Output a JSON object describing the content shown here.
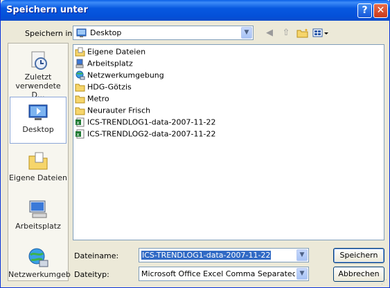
{
  "window": {
    "title": "Speichern unter"
  },
  "toolbar": {
    "save_in_label": "Speichern in:",
    "save_in_value": "Desktop"
  },
  "places": [
    {
      "label": "Zuletzt verwendete D..."
    },
    {
      "label": "Desktop"
    },
    {
      "label": "Eigene Dateien"
    },
    {
      "label": "Arbeitsplatz"
    },
    {
      "label": "Netzwerkumgeb"
    }
  ],
  "files": [
    {
      "name": "Eigene Dateien",
      "icon": "my-documents-icon"
    },
    {
      "name": "Arbeitsplatz",
      "icon": "my-computer-icon"
    },
    {
      "name": "Netzwerkumgebung",
      "icon": "network-icon"
    },
    {
      "name": "HDG-Götzis",
      "icon": "folder-icon"
    },
    {
      "name": "Metro",
      "icon": "folder-icon"
    },
    {
      "name": "Neurauter Frisch",
      "icon": "folder-icon"
    },
    {
      "name": "ICS-TRENDLOG1-data-2007-11-22",
      "icon": "excel-file-icon"
    },
    {
      "name": "ICS-TRENDLOG2-data-2007-11-22",
      "icon": "excel-file-icon"
    }
  ],
  "form": {
    "filename_label": "Dateiname:",
    "filename_value": "ICS-TRENDLOG1-data-2007-11-22",
    "filetype_label": "Dateityp:",
    "filetype_value": "Microsoft Office Excel Comma Separated Values"
  },
  "buttons": {
    "save": "Speichern",
    "cancel": "Abbrechen"
  }
}
